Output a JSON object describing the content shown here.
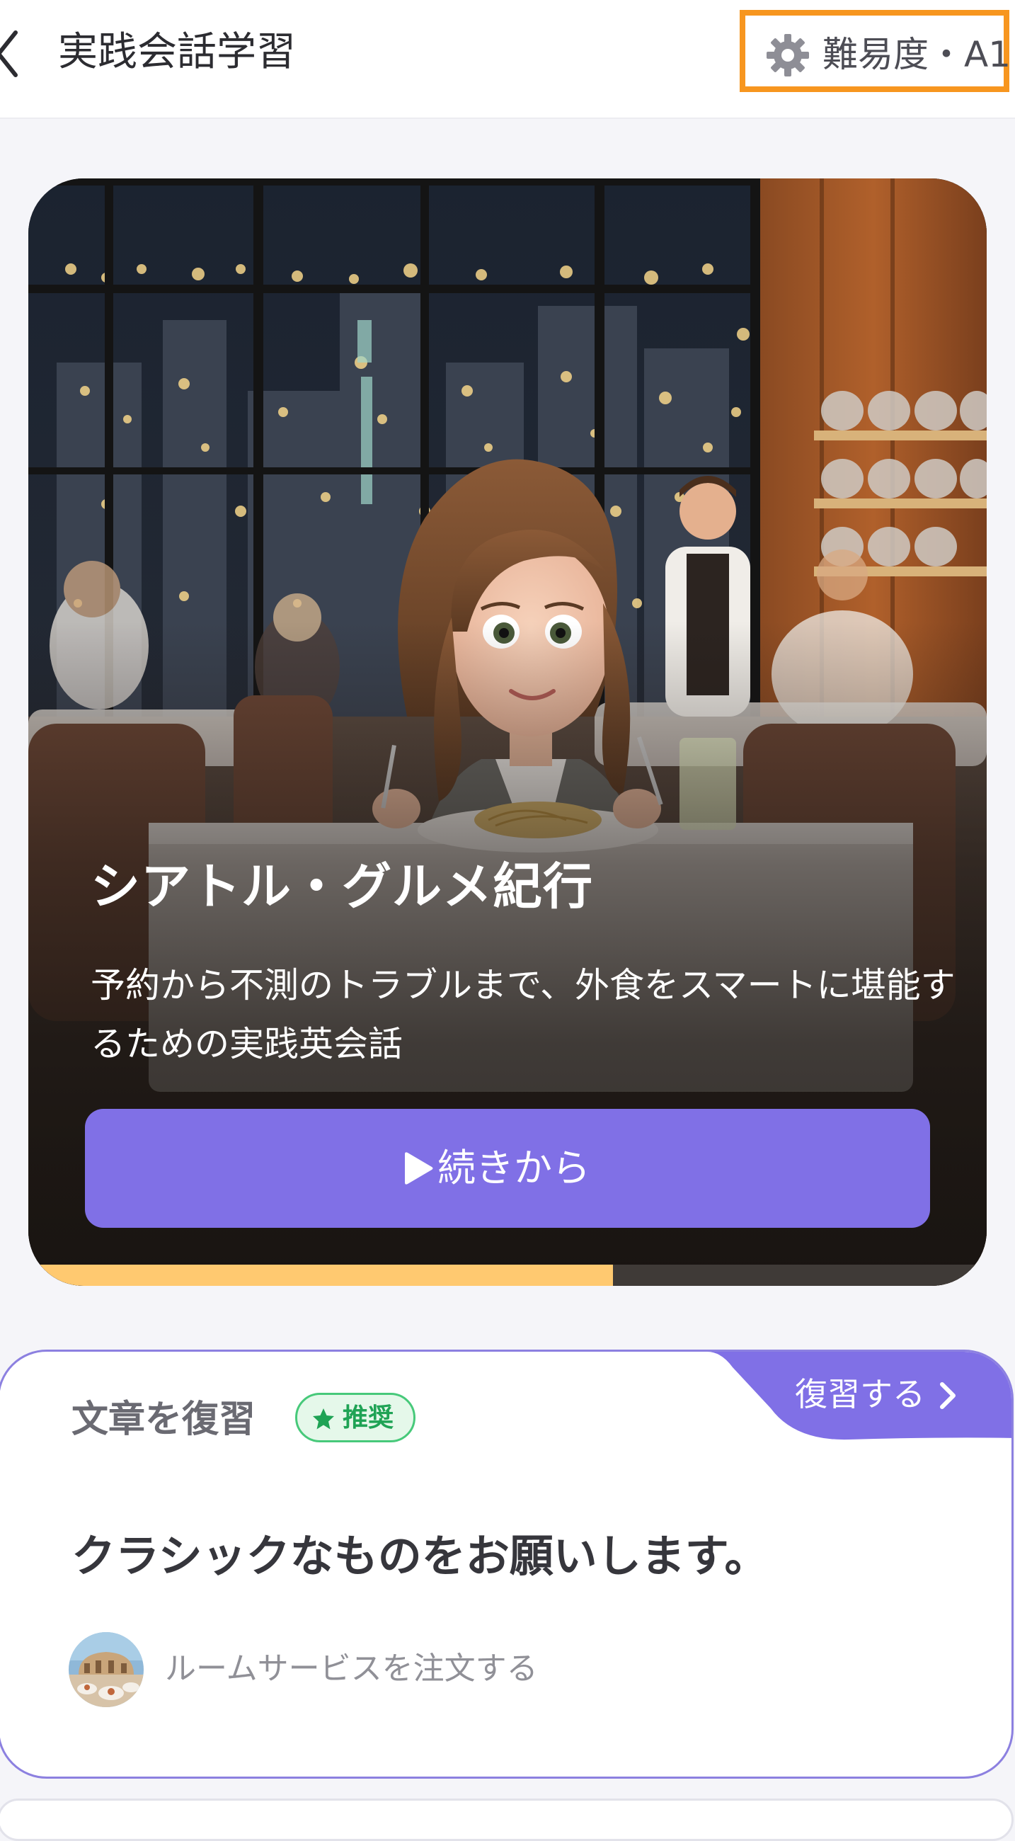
{
  "header": {
    "title": "実践会話学習",
    "difficulty_label": "難易度・A1"
  },
  "course": {
    "title": "シアトル・グルメ紀行",
    "description": "予約から不測のトラブルまで、外食をスマートに堪能するための実践英会話",
    "continue_label": "続きから",
    "progress": 0.61
  },
  "review": {
    "title": "文章を復習",
    "badge_label": "推奨",
    "action_label": "復習する",
    "sentence": "クラシックなものをお願いします。",
    "scene_name": "ルームサービスを注文する"
  },
  "colors": {
    "accent": "#8070e6",
    "progress": "#ffc970",
    "highlight_border": "#f7961f",
    "badge_green": "#1fa355"
  }
}
